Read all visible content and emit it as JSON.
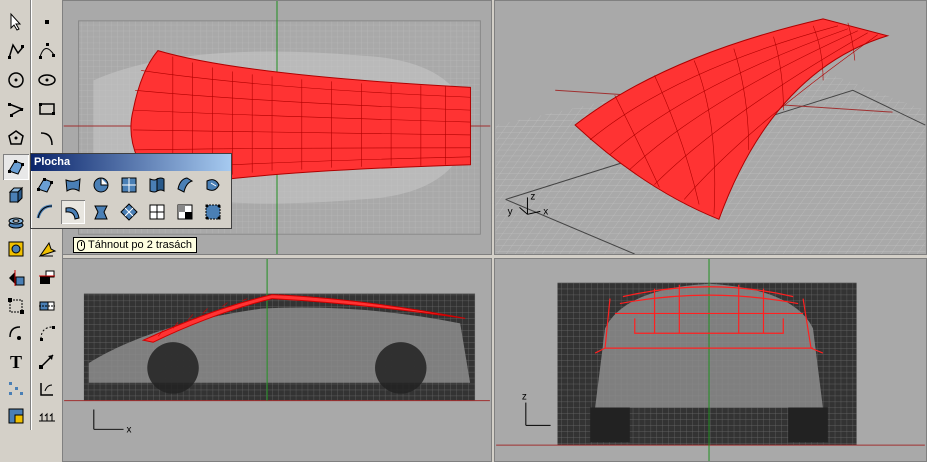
{
  "flyout": {
    "title": "Plocha"
  },
  "tooltip": {
    "text": "Táhnout po 2 trasách"
  },
  "axes": {
    "x": "x",
    "y": "y",
    "z": "z"
  },
  "colors": {
    "surface": "#ff2a2a",
    "surface_lines": "#b00000",
    "viewport_bg": "#a9a9a9",
    "grid": "#9a9a9a",
    "axis_x": "#a03030",
    "axis_y": "#209020",
    "title_bar": "#0a246a"
  },
  "toolbar": {
    "icons": [
      "select-arrow-icon",
      "point-icon",
      "polyline-icon",
      "control-points-curve-icon",
      "circle-icon",
      "ellipse-icon",
      "polygon-icon",
      "rectangle-icon",
      "polygon-star-icon",
      "arc-icon",
      "surface-from-points-icon",
      "fillet-icon",
      "box-solid-icon",
      "cylinder-icon",
      "cylinder-stack-icon",
      "boolean-icon",
      "join-icon",
      "explode-icon",
      "split-icon",
      "trim-icon",
      "group-icon",
      "rotate-icon",
      "array-icon",
      "text-icon",
      "scale-icon",
      "points-grid-icon",
      "dimension-icon",
      "render-icon",
      "mesh-icon"
    ]
  },
  "flyout_icons": [
    "surface-from-points-icon",
    "edge-curves-surface-icon",
    "revolve-icon",
    "planar-surface-icon",
    "extrude-surface-icon",
    "loft-icon",
    "rail-revolve-icon",
    "sweep-1-rail-icon",
    "sweep-2-rails-icon",
    "pipe-icon",
    "network-surface-icon",
    "patch-icon",
    "blend-surface-icon",
    "unroll-icon"
  ]
}
